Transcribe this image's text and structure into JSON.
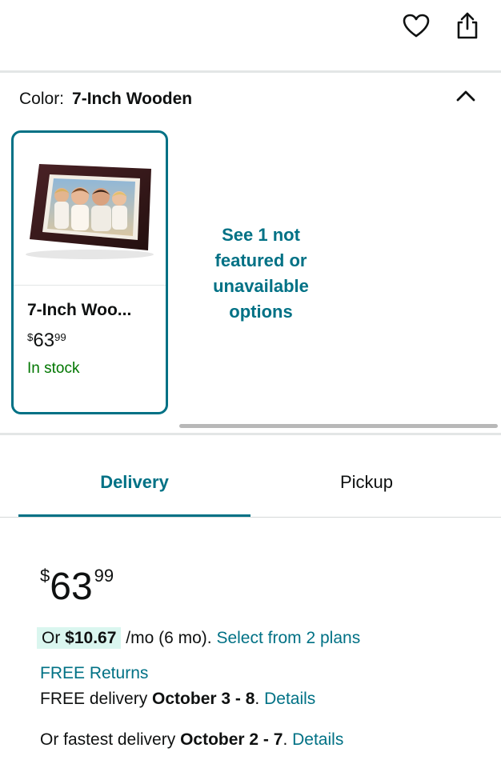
{
  "header": {
    "favorite_icon": "heart-icon",
    "share_icon": "share-icon"
  },
  "variation": {
    "label": "Color:",
    "value": "7-Inch Wooden",
    "collapse_icon": "chevron-up-icon",
    "option": {
      "name": "7-Inch Woo...",
      "price_currency": "$",
      "price_whole": "63",
      "price_fraction": "99",
      "stock": "In stock"
    },
    "see_more": "See 1 not featured or unavailable options"
  },
  "tabs": [
    {
      "label": "Delivery",
      "selected": true
    },
    {
      "label": "Pickup",
      "selected": false
    }
  ],
  "buybox": {
    "price_currency": "$",
    "price_whole": "63",
    "price_fraction": "99",
    "installment_prefix": "Or ",
    "installment_amount": "$10.67",
    "installment_suffix": " /mo (6 mo). ",
    "installment_link": "Select from 2 plans",
    "returns": "FREE Returns",
    "delivery_prefix": "FREE delivery ",
    "delivery_dates": "October 3 - 8",
    "delivery_link": "Details",
    "fastest_prefix": "Or fastest delivery ",
    "fastest_dates": "October 2 - 7",
    "fastest_link": "Details",
    "period": "."
  },
  "colors": {
    "accent": "#007185",
    "stock_green": "#007600",
    "highlight": "#daf6ef"
  }
}
